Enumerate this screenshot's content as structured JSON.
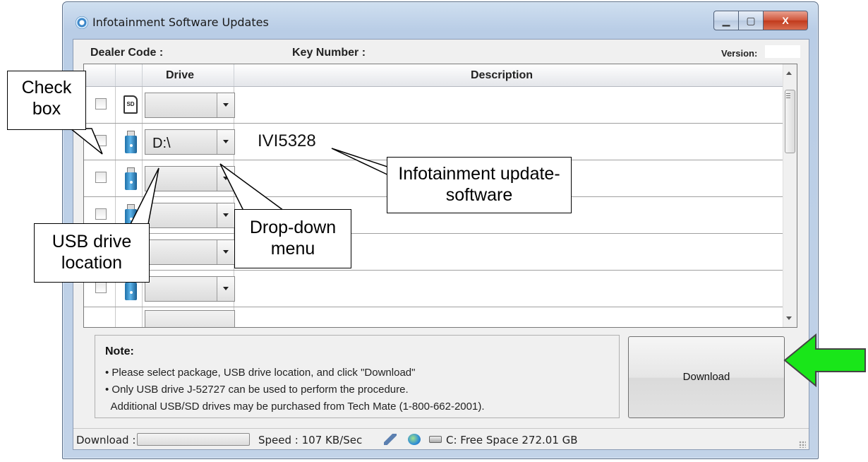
{
  "window": {
    "title": "Infotainment Software Updates",
    "buttons": {
      "minimize": "_",
      "maximize": "□",
      "close": "X"
    }
  },
  "header": {
    "dealer_code_label": "Dealer Code :",
    "key_number_label": "Key Number :",
    "version_label": "Version:"
  },
  "grid": {
    "columns": [
      "",
      "",
      "Drive",
      "Description"
    ],
    "rows": [
      {
        "checked": false,
        "icon": "sd-card-icon",
        "icon_text": "SD",
        "drive": "",
        "description": ""
      },
      {
        "checked": false,
        "icon": "usb-drive-icon",
        "drive": "D:\\",
        "description": "IVI5328"
      },
      {
        "checked": false,
        "icon": "usb-drive-icon",
        "drive": "",
        "description": ""
      },
      {
        "checked": false,
        "icon": "usb-drive-icon",
        "drive": "",
        "description": ""
      },
      {
        "checked": false,
        "icon": "usb-drive-icon",
        "drive": "",
        "description": ""
      },
      {
        "checked": false,
        "icon": "usb-drive-icon",
        "drive": "",
        "description": ""
      }
    ]
  },
  "note": {
    "title": "Note:",
    "lines": [
      "• Please select package, USB drive location, and click \"Download\"",
      "• Only USB drive J-52727 can be used to perform the procedure.",
      "  Additional USB/SD drives may be purchased from Tech Mate (1-800-662-2001)."
    ]
  },
  "download_button": "Download",
  "status": {
    "download_label": "Download :",
    "speed": "Speed : 107 KB/Sec",
    "free_space": "C: Free Space 272.01 GB"
  },
  "callouts": {
    "check_box": "Check box",
    "usb_location": "USB drive location",
    "dropdown": "Drop-down menu",
    "software": "Infotainment update-software"
  },
  "colors": {
    "arrow": "#19e619",
    "title_bg": "#c4d6ec"
  }
}
